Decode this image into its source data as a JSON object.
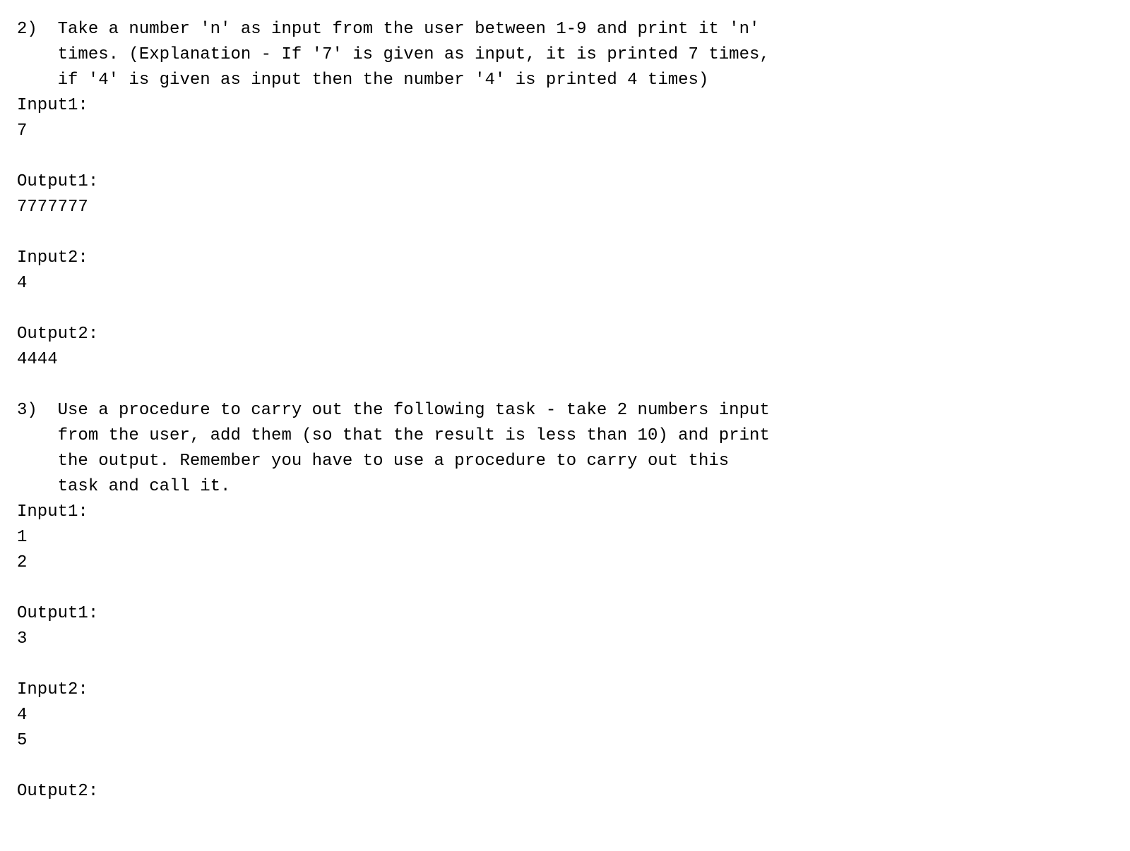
{
  "lines": [
    "2)  Take a number 'n' as input from the user between 1-9 and print it 'n'",
    "    times. (Explanation - If '7' is given as input, it is printed 7 times,",
    "    if '4' is given as input then the number '4' is printed 4 times)",
    "Input1:",
    "7",
    "",
    "Output1:",
    "7777777",
    "",
    "Input2:",
    "4",
    "",
    "Output2:",
    "4444",
    "",
    "3)  Use a procedure to carry out the following task - take 2 numbers input",
    "    from the user, add them (so that the result is less than 10) and print",
    "    the output. Remember you have to use a procedure to carry out this",
    "    task and call it.",
    "Input1:",
    "1",
    "2",
    "",
    "Output1:",
    "3",
    "",
    "Input2:",
    "4",
    "5",
    "",
    "Output2:"
  ]
}
